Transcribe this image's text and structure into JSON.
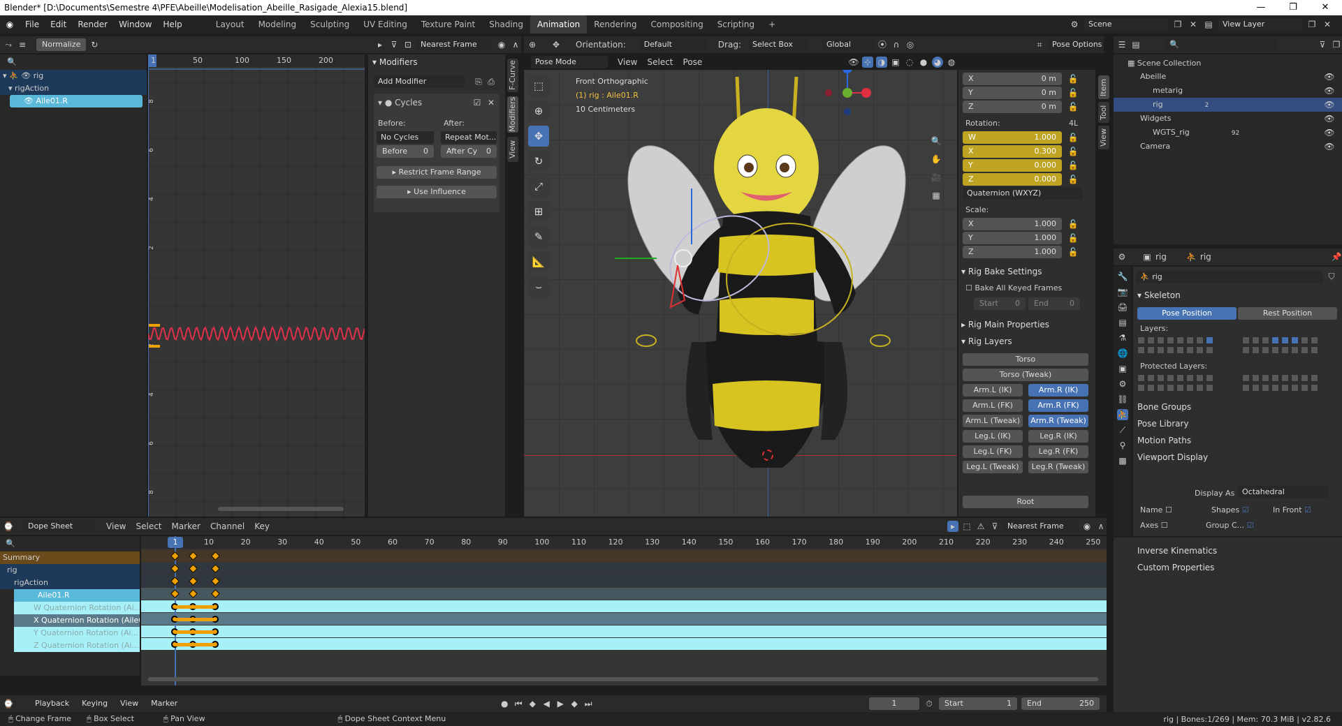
{
  "window": {
    "title": "Blender* [D:\\Documents\\Semestre 4\\PFE\\Abeille\\Modelisation_Abeille_Rasigade_Alexia15.blend]",
    "minimize": "—",
    "maximize": "❐",
    "close": "✕"
  },
  "menu": [
    "File",
    "Edit",
    "Render",
    "Window",
    "Help"
  ],
  "workspaces": [
    "Layout",
    "Modeling",
    "Sculpting",
    "UV Editing",
    "Texture Paint",
    "Shading",
    "Animation",
    "Rendering",
    "Compositing",
    "Scripting"
  ],
  "workspace_add": "+",
  "active_workspace": "Animation",
  "scene": {
    "label": "Scene",
    "view_layer": "View Layer"
  },
  "graph": {
    "normalize": "Normalize",
    "interpolation": "Nearest Frame",
    "frame_ticks": [
      "1",
      "50",
      "100",
      "150",
      "200"
    ],
    "value_ticks": [
      "8",
      "6",
      "4",
      "2",
      "2",
      "4",
      "6",
      "8"
    ],
    "channels": [
      "rig",
      "rigAction",
      "Aile01.R"
    ]
  },
  "modifiers": {
    "tab": "Modifiers",
    "add": "Add Modifier",
    "name": "Cycles",
    "before_label": "Before:",
    "after_label": "After:",
    "before_mode": "No Cycles",
    "after_mode": "Repeat Mot...",
    "before_count_label": "Before",
    "before_count": "0",
    "after_count_label": "After Cy",
    "after_count": "0",
    "restrict": "Restrict Frame Range",
    "influence": "Use Influence",
    "side_tabs": [
      "F-Curve",
      "Modifiers",
      "View"
    ]
  },
  "viewport": {
    "orientation_label": "Orientation:",
    "orientation": "Default",
    "drag_label": "Drag:",
    "drag": "Select Box",
    "transform": "Global",
    "pose_options": "Pose Options",
    "mode": "Pose Mode",
    "menus": [
      "View",
      "Select",
      "Pose"
    ],
    "overlay_title": "Front Orthographic",
    "overlay_obj": "(1) rig : Aile01.R",
    "overlay_scale": "10 Centimeters",
    "side_tabs": [
      "Item",
      "Tool",
      "View"
    ]
  },
  "npanel": {
    "loc": [
      {
        "axis": "X",
        "val": "0 m"
      },
      {
        "axis": "Y",
        "val": "0 m"
      },
      {
        "axis": "Z",
        "val": "0 m"
      }
    ],
    "rotation_label": "Rotation:",
    "rotation_mode_tag": "4L",
    "rot": [
      {
        "axis": "W",
        "val": "1.000"
      },
      {
        "axis": "X",
        "val": "0.300"
      },
      {
        "axis": "Y",
        "val": "0.000"
      },
      {
        "axis": "Z",
        "val": "0.000"
      }
    ],
    "rot_mode": "Quaternion (WXYZ)",
    "scale_label": "Scale:",
    "scale": [
      {
        "axis": "X",
        "val": "1.000"
      },
      {
        "axis": "Y",
        "val": "1.000"
      },
      {
        "axis": "Z",
        "val": "1.000"
      }
    ],
    "bake_title": "Rig Bake Settings",
    "bake_all": "Bake All Keyed Frames",
    "start_label": "Start",
    "start": "0",
    "end_label": "End",
    "end": "0",
    "main_props": "Rig Main Properties",
    "layers_title": "Rig Layers",
    "torso": "Torso",
    "torso_tweak": "Torso (Tweak)",
    "layer_rows": [
      [
        "Arm.L (IK)",
        "Arm.R (IK)"
      ],
      [
        "Arm.L (FK)",
        "Arm.R (FK)"
      ],
      [
        "Arm.L (Tweak)",
        "Arm.R (Tweak)"
      ],
      [
        "Leg.L (IK)",
        "Leg.R (IK)"
      ],
      [
        "Leg.L (FK)",
        "Leg.R (FK)"
      ],
      [
        "Leg.L (Tweak)",
        "Leg.R (Tweak)"
      ]
    ],
    "root": "Root"
  },
  "outliner": {
    "collection": "Scene Collection",
    "items": [
      {
        "name": "Abeille",
        "indent": 1
      },
      {
        "name": "metarig",
        "indent": 2
      },
      {
        "name": "rig",
        "indent": 2,
        "badge": "2"
      },
      {
        "name": "Widgets",
        "indent": 1
      },
      {
        "name": "WGTS_rig",
        "indent": 2,
        "badge": "92"
      },
      {
        "name": "Camera",
        "indent": 1
      }
    ]
  },
  "props": {
    "obj": "rig",
    "data": "rig",
    "field": "rig",
    "skeleton": "Skeleton",
    "pose_pos": "Pose Position",
    "rest_pos": "Rest Position",
    "layers": "Layers:",
    "protected": "Protected Layers:",
    "sections": [
      "Bone Groups",
      "Pose Library",
      "Motion Paths",
      "Viewport Display"
    ],
    "display_as_label": "Display As",
    "display_as": "Octahedral",
    "name": "Name",
    "shapes": "Shapes",
    "in_front": "In Front",
    "axes": "Axes",
    "group_c": "Group C...",
    "sections2": [
      "Inverse Kinematics",
      "Custom Properties"
    ]
  },
  "dopesheet": {
    "mode": "Dope Sheet",
    "menus": [
      "View",
      "Select",
      "Marker",
      "Channel",
      "Key"
    ],
    "interpolation": "Nearest Frame",
    "current_frame": "1",
    "ticks": [
      "10",
      "20",
      "30",
      "40",
      "50",
      "60",
      "70",
      "80",
      "90",
      "100",
      "110",
      "120",
      "130",
      "140",
      "150",
      "160",
      "170",
      "180",
      "190",
      "200",
      "210",
      "220",
      "230",
      "240",
      "250"
    ],
    "channels": [
      "Summary",
      "rig",
      "rigAction",
      "Aile01.R",
      "W Quaternion Rotation (Ai...",
      "X Quaternion Rotation (Aile0...",
      "Y Quaternion Rotation (Ai...",
      "Z Quaternion Rotation (Ai..."
    ],
    "key_frames": [
      1,
      6,
      12
    ]
  },
  "timeline": {
    "menus": [
      "Playback",
      "Keying",
      "View",
      "Marker"
    ],
    "frame": "1",
    "start_label": "Start",
    "start": "1",
    "end_label": "End",
    "end": "250"
  },
  "status": {
    "items": [
      "Change Frame",
      "Box Select",
      "Pan View",
      "Dope Sheet Context Menu"
    ],
    "right": "rig | Bones:1/269 | Mem: 70.3 MiB | v2.82.6"
  },
  "colors": {
    "accent": "#4772b3",
    "curve": "#e0304a",
    "keyframe": "#f0a000",
    "selected_row": "#a8f0f8"
  }
}
